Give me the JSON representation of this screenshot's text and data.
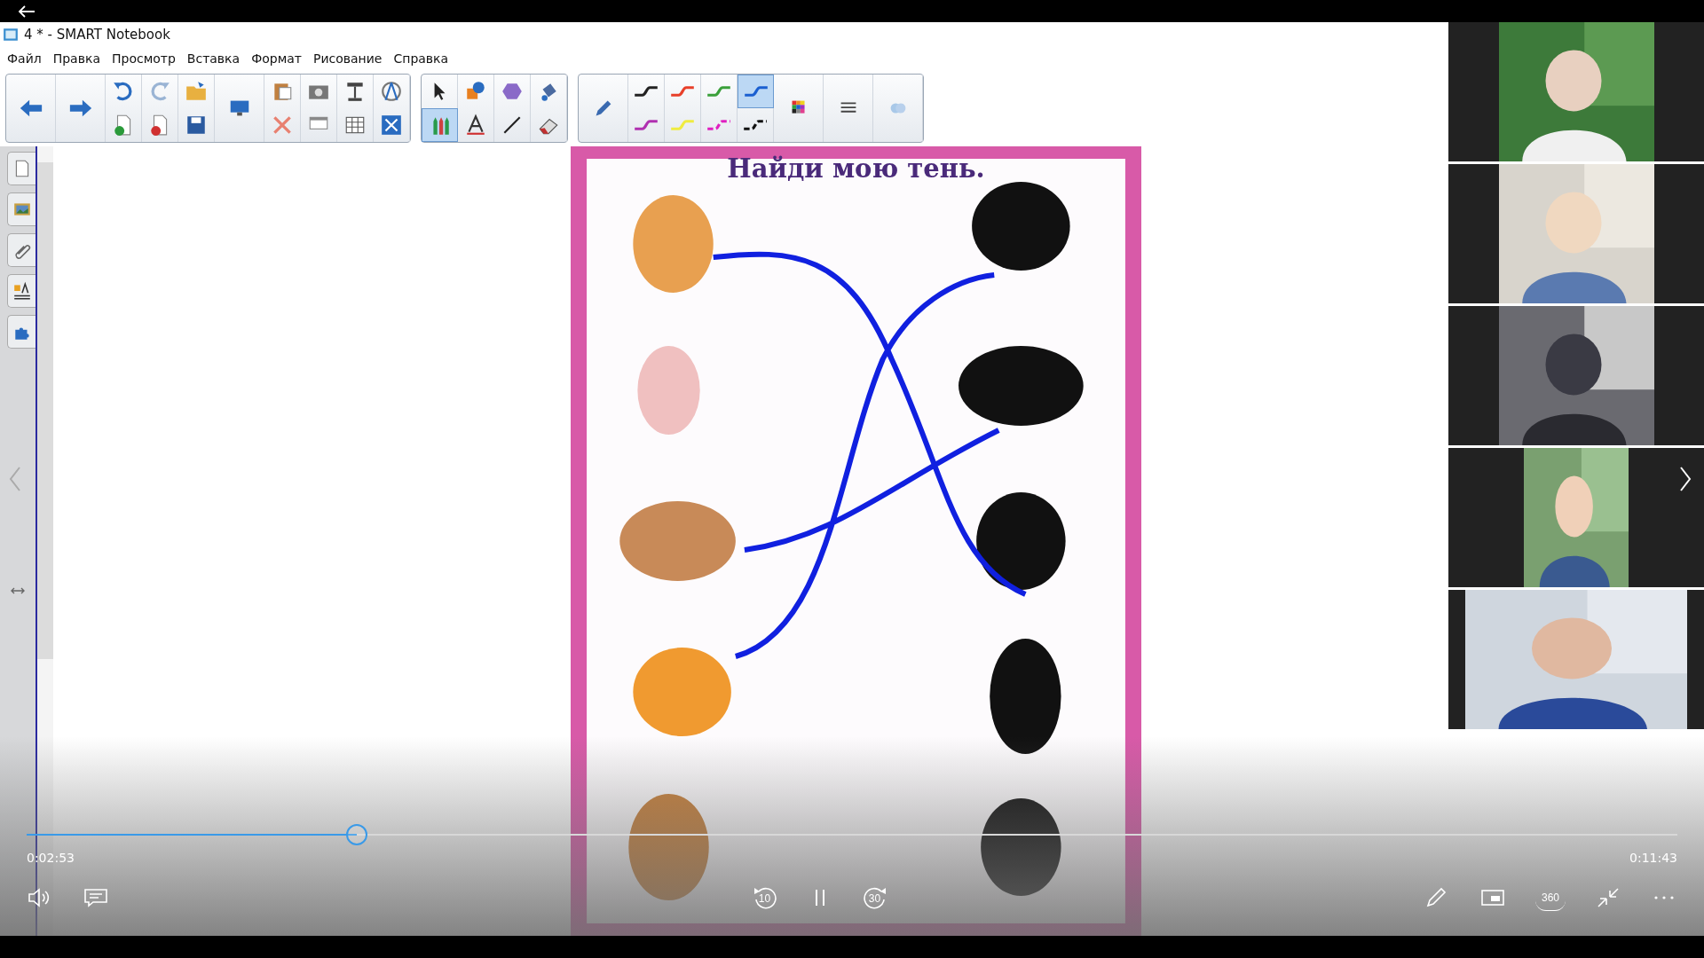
{
  "window": {
    "title": "4 * - SMART Notebook"
  },
  "menu": [
    "Файл",
    "Правка",
    "Просмотр",
    "Вставка",
    "Формат",
    "Рисование",
    "Справка"
  ],
  "pens": [
    {
      "kind": "solid",
      "color": "#222222",
      "selected": false
    },
    {
      "kind": "solid",
      "color": "#e8402a",
      "selected": false
    },
    {
      "kind": "solid",
      "color": "#3aa03a",
      "selected": false
    },
    {
      "kind": "solid",
      "color": "#1a5fd0",
      "selected": true
    },
    {
      "kind": "solid",
      "color": "#b030b0",
      "selected": false
    },
    {
      "kind": "solid",
      "color": "#f0ec40",
      "selected": false
    },
    {
      "kind": "dashed",
      "color": "#e020c0",
      "selected": false
    },
    {
      "kind": "dashed",
      "color": "#111111",
      "selected": false
    }
  ],
  "page": {
    "title": "Найди мою тень."
  },
  "player": {
    "elapsed": "0:02:53",
    "duration": "0:11:43",
    "level": 0.2,
    "skip_back": "10",
    "skip_forward": "30",
    "view_360": "360"
  }
}
